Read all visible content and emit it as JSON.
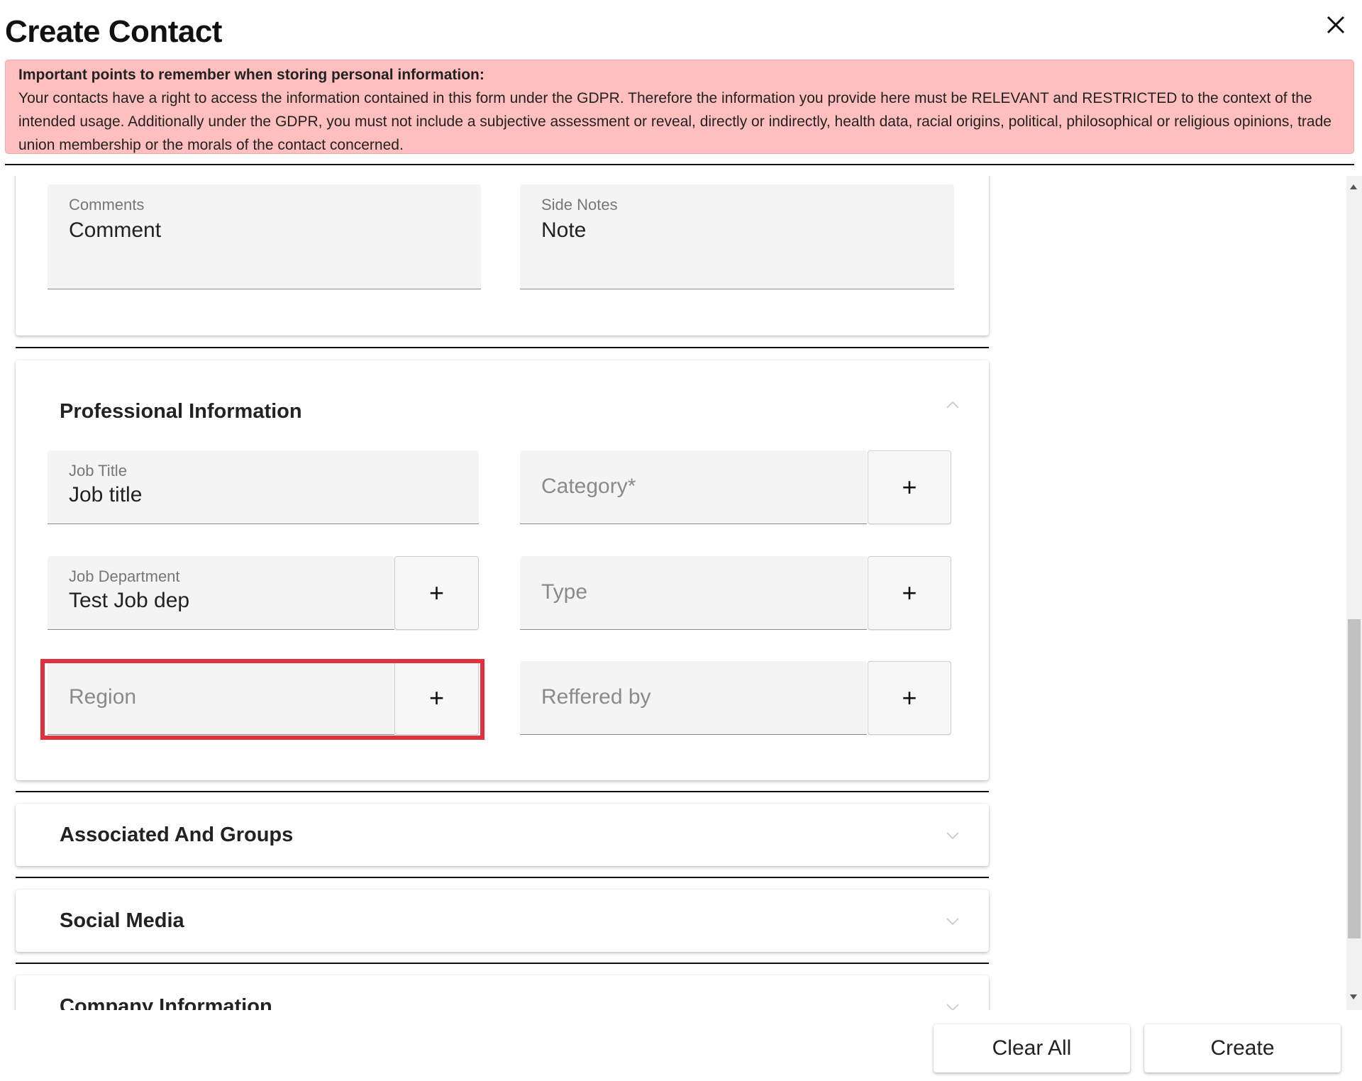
{
  "dialog": {
    "title": "Create Contact",
    "close_icon": "close-icon"
  },
  "notice": {
    "heading": "Important points to remember when storing personal information:",
    "body": "Your contacts have a right to access the information contained in this form under the GDPR. Therefore the information you provide here must be RELEVANT and RESTRICTED to the context of the intended usage. Additionally under the GDPR, you must not include a subjective assessment or reveal, directly or indirectly, health data, racial origins, political, philosophical or religious opinions, trade union membership or the morals of the contact concerned."
  },
  "notes_card": {
    "comments": {
      "label": "Comments",
      "value": "Comment"
    },
    "side_notes": {
      "label": "Side Notes",
      "value": "Note"
    }
  },
  "professional": {
    "title": "Professional Information",
    "expanded": true,
    "job_title": {
      "label": "Job Title",
      "value": "Job title"
    },
    "category": {
      "placeholder": "Category*"
    },
    "job_department": {
      "label": "Job Department",
      "value": "Test Job dep"
    },
    "type": {
      "placeholder": "Type"
    },
    "region": {
      "placeholder": "Region"
    },
    "referred_by": {
      "placeholder": "Reffered by"
    },
    "add_symbol": "+"
  },
  "sections": {
    "associated": "Associated And Groups",
    "social": "Social Media",
    "company": "Company Information"
  },
  "footer": {
    "clear_label": "Clear All",
    "create_label": "Create"
  },
  "colors": {
    "notice_bg": "#ffbfbf",
    "highlight": "#e0313c"
  }
}
